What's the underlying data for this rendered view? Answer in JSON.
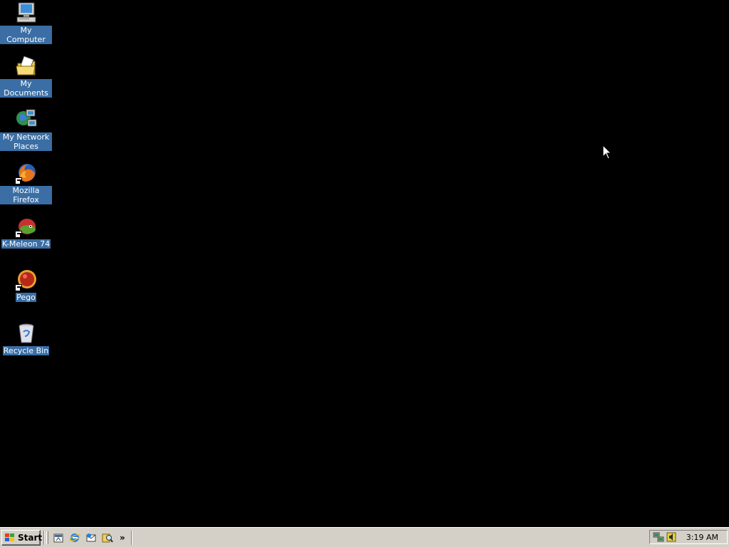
{
  "desktop": {
    "background": "#000000",
    "label_highlight": "#3a6ea5",
    "icons": [
      {
        "label": "My Computer",
        "icon": "computer-icon"
      },
      {
        "label": "My Documents",
        "icon": "documents-folder-icon"
      },
      {
        "label": "My Network Places",
        "icon": "network-places-icon"
      },
      {
        "label": "Mozilla Firefox",
        "icon": "firefox-icon",
        "shortcut": true
      },
      {
        "label": "K-Meleon 74",
        "icon": "k-meleon-icon",
        "shortcut": true
      },
      {
        "label": "Pego",
        "icon": "pego-icon",
        "shortcut": true
      },
      {
        "label": "Recycle Bin",
        "icon": "recycle-bin-icon"
      }
    ]
  },
  "taskbar": {
    "background": "#d4d0c8",
    "start_label": "Start",
    "quick_launch": [
      {
        "icon": "show-desktop-icon"
      },
      {
        "icon": "internet-explorer-icon"
      },
      {
        "icon": "outlook-express-icon"
      },
      {
        "icon": "search-icon"
      }
    ],
    "more_label": "»",
    "tray": {
      "icons": [
        {
          "icon": "network-tray-icon"
        },
        {
          "icon": "volume-tray-icon"
        }
      ],
      "clock": "3:19 AM"
    }
  }
}
